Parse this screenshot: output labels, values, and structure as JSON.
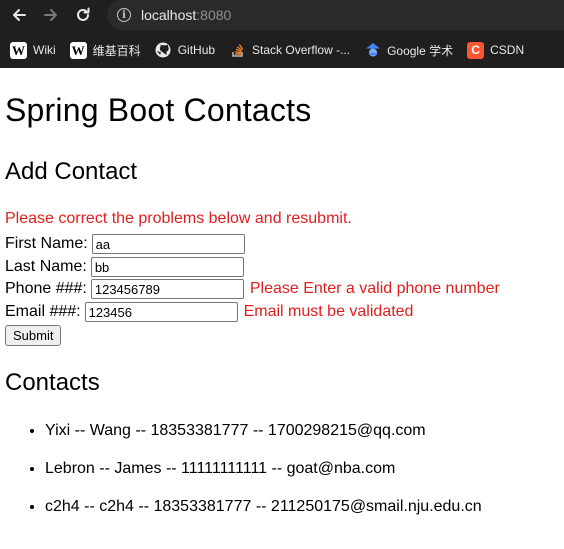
{
  "browser": {
    "url_host": "localhost",
    "url_port": ":8080",
    "bookmarks": [
      {
        "label": "Wiki",
        "icon": "wikipedia-icon"
      },
      {
        "label": "维基百科",
        "icon": "wikipedia-icon"
      },
      {
        "label": "GitHub",
        "icon": "github-icon"
      },
      {
        "label": "Stack Overflow -...",
        "icon": "stackoverflow-icon"
      },
      {
        "label": "Google 学术",
        "icon": "google-scholar-icon"
      },
      {
        "label": "CSDN",
        "icon": "csdn-icon"
      }
    ]
  },
  "page": {
    "title": "Spring Boot Contacts",
    "add_heading": "Add Contact",
    "error_banner": "Please correct the problems below and resubmit.",
    "form": {
      "first_name_label": "First Name:",
      "first_name_value": "aa",
      "last_name_label": "Last Name:",
      "last_name_value": "bb",
      "phone_label": "Phone ###:",
      "phone_value": "123456789",
      "phone_error": "Please Enter a valid phone number",
      "email_label": "Email ###:",
      "email_value": "123456",
      "email_error": "Email must be validated",
      "submit_label": "Submit"
    },
    "contacts_heading": "Contacts",
    "contacts": [
      "Yixi -- Wang -- 18353381777 -- 1700298215@qq.com",
      "Lebron -- James -- 11111111111 -- goat@nba.com",
      "c2h4 -- c2h4 -- 18353381777 -- 211250175@smail.nju.edu.cn"
    ]
  },
  "colors": {
    "error": "#e01e1e",
    "chrome_bg": "#1f1f1f"
  }
}
